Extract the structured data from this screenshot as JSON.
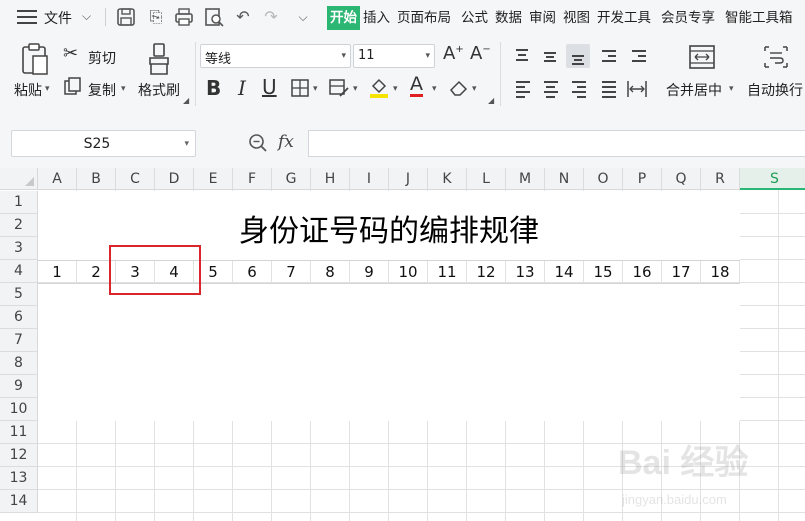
{
  "menubar": {
    "file_label": "文件",
    "tabs": [
      "开始",
      "插入",
      "页面布局",
      "公式",
      "数据",
      "审阅",
      "视图",
      "开发工具",
      "会员专享",
      "智能工具箱"
    ]
  },
  "ribbon": {
    "paste": "粘贴",
    "cut": "剪切",
    "copy": "复制",
    "format_painter": "格式刷",
    "font_name": "等线",
    "font_size": "11",
    "merge_center": "合并居中",
    "auto_wrap": "自动换行"
  },
  "formula_bar": {
    "cell_ref": "S25",
    "fx": "fx",
    "formula": ""
  },
  "sheet": {
    "columns": [
      "A",
      "B",
      "C",
      "D",
      "E",
      "F",
      "G",
      "H",
      "I",
      "J",
      "K",
      "L",
      "M",
      "N",
      "O",
      "P",
      "Q",
      "R",
      "S"
    ],
    "selected_column": "S",
    "rows": [
      "1",
      "2",
      "3",
      "4",
      "5",
      "6",
      "7",
      "8",
      "9",
      "10",
      "11",
      "12",
      "13",
      "14"
    ],
    "title": "身份证号码的编排规律",
    "row4_values": [
      "1",
      "2",
      "3",
      "4",
      "5",
      "6",
      "7",
      "8",
      "9",
      "10",
      "11",
      "12",
      "13",
      "14",
      "15",
      "16",
      "17",
      "18"
    ]
  },
  "watermark": {
    "text": "Bai 经验",
    "url": "jingyan.baidu.com"
  },
  "colors": {
    "accent": "#2bb673",
    "highlight_box": "#d9262c"
  }
}
